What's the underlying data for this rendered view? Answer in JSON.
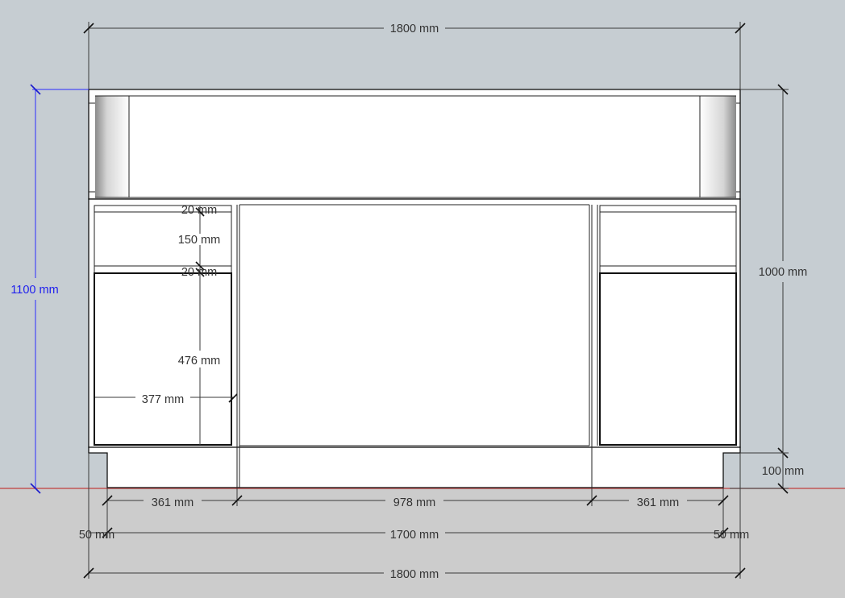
{
  "dimensions": {
    "overall_width_top": "1800 mm",
    "overall_height": "1100 mm",
    "cabinet_height": "1000 mm",
    "plinth_height": "100 mm",
    "drawer_gap_top": "20 mm",
    "drawer_height": "150 mm",
    "drawer_gap_mid": "20 mm",
    "door_height": "476 mm",
    "door_width": "377 mm",
    "left_bay": "361 mm",
    "center_bay": "978 mm",
    "right_bay": "361 mm",
    "left_inset": "50 mm",
    "inner_width": "1700 mm",
    "right_inset": "50 mm",
    "overall_width_bottom": "1800 mm"
  }
}
